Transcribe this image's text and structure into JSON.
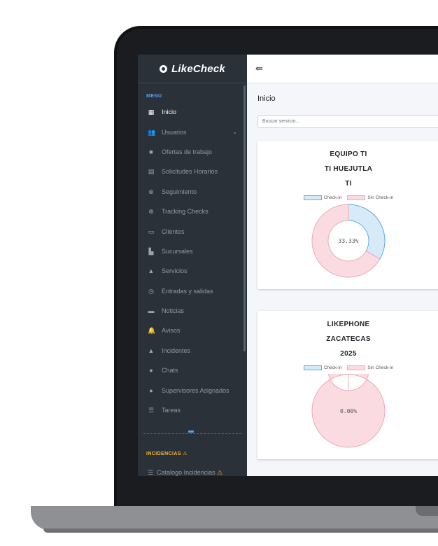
{
  "sidebar": {
    "brand": {
      "icon": "clock-logo-icon",
      "text_like": "Like",
      "text_check": "Check"
    },
    "menu_heading": "MENU",
    "items": [
      {
        "label": "Inicio",
        "icon": "dashboard-icon",
        "active": true
      },
      {
        "label": "Usuarios",
        "icon": "users-icon",
        "has_submenu": true
      },
      {
        "label": "Ofertas de trabajo",
        "icon": "briefcase-icon"
      },
      {
        "label": "Solicitudes Horarios",
        "icon": "schedule-request-icon"
      },
      {
        "label": "Seguimiento",
        "icon": "crosshair-icon"
      },
      {
        "label": "Tracking Checks",
        "icon": "tracking-icon"
      },
      {
        "label": "Clientes",
        "icon": "clients-icon"
      },
      {
        "label": "Sucursales",
        "icon": "branch-icon"
      },
      {
        "label": "Servicios",
        "icon": "services-icon"
      },
      {
        "label": "Entradas y salidas",
        "icon": "clock-check-icon"
      },
      {
        "label": "Noticias",
        "icon": "news-icon"
      },
      {
        "label": "Avisos",
        "icon": "bell-icon"
      },
      {
        "label": "Incidentes",
        "icon": "warning-icon"
      },
      {
        "label": "Chats",
        "icon": "chat-icon"
      },
      {
        "label": "Supervisores Asignados",
        "icon": "supervisor-icon"
      },
      {
        "label": "Tareas",
        "icon": "task-list-icon"
      }
    ],
    "incidencias_heading": "INCIDENCIAS",
    "incidencias_item": "Catalogo Incidencias"
  },
  "topbar": {
    "toggle_icon": "sidebar-collapse-icon"
  },
  "main": {
    "page_title": "Inicio",
    "search_placeholder": "Buscar servicio...",
    "cards": [
      {
        "lines": [
          "EQUIPO TI",
          "TI HUEJUTLA",
          "TI"
        ],
        "legend": [
          "Check-in",
          "Sin Check-in"
        ],
        "center_label": "33.33%",
        "checkin_fraction": 0.3333
      },
      {
        "lines": [
          "LIKEPHONE",
          "ZACATECAS",
          "2025"
        ],
        "legend": [
          "Check-in",
          "Sin Check-in"
        ],
        "center_label": "0.00%",
        "checkin_fraction": 0.0
      }
    ]
  },
  "colors": {
    "sidebar_bg": "#2b3138",
    "checkin_fill": "#d6eaf8",
    "checkin_border": "#5dade2",
    "sin_checkin_fill": "#fadbe1",
    "sin_checkin_border": "#f1a9b8",
    "incidencias_accent": "#f6b73c"
  }
}
